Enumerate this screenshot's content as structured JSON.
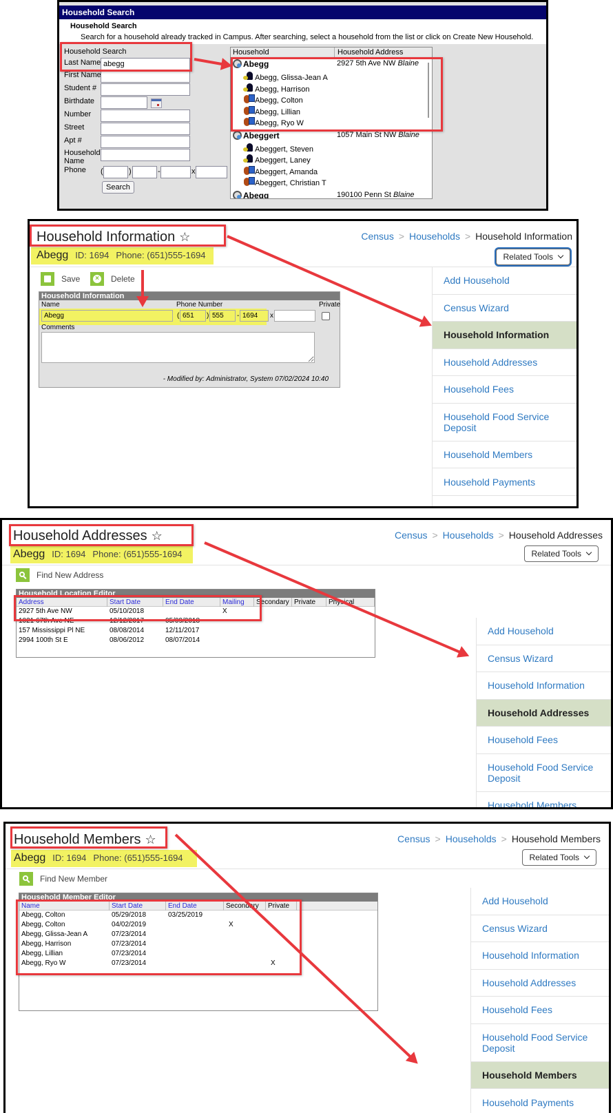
{
  "search_panel": {
    "window_title": "Household Search",
    "heading": "Household Search",
    "instructions": "Search for a household already tracked in Campus. After searching, select a household from the list or click on Create New Household.",
    "form_title": "Household Search",
    "fields": {
      "last_name_label": "Last Name",
      "last_name_value": "abegg",
      "first_name_label": "First Name",
      "student_num_label": "Student #",
      "birthdate_label": "Birthdate",
      "number_label": "Number",
      "street_label": "Street",
      "apt_label": "Apt #",
      "household_name_label": "Household Name",
      "phone_label": "Phone",
      "phone_paren_open": "(",
      "phone_paren_close": ")",
      "phone_dash": "-",
      "phone_ext": "x"
    },
    "search_button": "Search",
    "results": {
      "col_household": "Household",
      "col_address": "Household Address",
      "households": [
        {
          "name": "Abegg",
          "address": "2927 5th Ave NW",
          "city": "Blaine",
          "members": [
            {
              "name": "Abegg, Glissa-Jean A",
              "icon": "parent-icon"
            },
            {
              "name": "Abegg, Harrison",
              "icon": "parent-icon"
            },
            {
              "name": "Abegg, Colton",
              "icon": "student-icon"
            },
            {
              "name": "Abegg, Lillian",
              "icon": "student-icon"
            },
            {
              "name": "Abegg, Ryo W",
              "icon": "student-icon"
            }
          ]
        },
        {
          "name": "Abeggert",
          "address": "1057 Main St NW",
          "city": "Blaine",
          "members": [
            {
              "name": "Abeggert, Steven",
              "icon": "parent-icon"
            },
            {
              "name": "Abeggert, Laney",
              "icon": "parent-icon"
            },
            {
              "name": "Abeggert, Amanda",
              "icon": "student-icon"
            },
            {
              "name": "Abeggert, Christian T",
              "icon": "student-icon"
            }
          ]
        },
        {
          "name": "Abegg",
          "address": "190100 Penn St",
          "city": "Blaine",
          "members": []
        }
      ]
    }
  },
  "common": {
    "household_name": "Abegg",
    "household_id": "ID: 1694",
    "household_phone": "Phone: (651)555-1694",
    "breadcrumb_census": "Census",
    "breadcrumb_households": "Households",
    "related_tools": "Related Tools",
    "sidebar": [
      "Add Household",
      "Census Wizard",
      "Household Information",
      "Household Addresses",
      "Household Fees",
      "Household Food Service Deposit",
      "Household Members",
      "Household Payments"
    ]
  },
  "info_page": {
    "title": "Household Information",
    "breadcrumb_current": "Household Information",
    "active_sidebar": "Household Information",
    "save_label": "Save",
    "delete_label": "Delete",
    "editor_title": "Household Information",
    "name_label": "Name",
    "name_value": "Abegg",
    "phone_label": "Phone Number",
    "phone_area": "651",
    "phone_prefix": "555",
    "phone_line": "1694",
    "phone_ext": "",
    "private_label": "Private",
    "private_checked": false,
    "comments_label": "Comments",
    "comments_value": "",
    "modified_by": "- Modified by: Administrator, System 07/02/2024 10:40"
  },
  "addresses_page": {
    "title": "Household Addresses",
    "breadcrumb_current": "Household Addresses",
    "active_sidebar": "Household Addresses",
    "find_label": "Find New Address",
    "editor_title": "Household Location Editor",
    "columns": [
      "Address",
      "Start Date",
      "End Date",
      "Mailing",
      "Secondary",
      "Private",
      "Physical"
    ],
    "rows": [
      {
        "address": "2927 5th Ave NW",
        "start": "05/10/2018",
        "end": "",
        "mailing": "X",
        "secondary": "",
        "private": "",
        "physical": ""
      },
      {
        "address": "1021 67th Ave NE",
        "start": "12/12/2017",
        "end": "05/09/2018",
        "mailing": "",
        "secondary": "",
        "private": "",
        "physical": ""
      },
      {
        "address": "157 Mississippi Pl NE",
        "start": "08/08/2014",
        "end": "12/11/2017",
        "mailing": "",
        "secondary": "",
        "private": "",
        "physical": ""
      },
      {
        "address": "2994 100th St E",
        "start": "08/06/2012",
        "end": "08/07/2014",
        "mailing": "",
        "secondary": "",
        "private": "",
        "physical": ""
      }
    ]
  },
  "members_page": {
    "title": "Household Members",
    "breadcrumb_current": "Household Members",
    "active_sidebar": "Household Members",
    "find_label": "Find New Member",
    "editor_title": "Household Member Editor",
    "columns": [
      "Name",
      "Start Date",
      "End Date",
      "Secondary",
      "Private"
    ],
    "rows": [
      {
        "name": "Abegg, Colton",
        "start": "05/29/2018",
        "end": "03/25/2019",
        "secondary": "",
        "private": ""
      },
      {
        "name": "Abegg, Colton",
        "start": "04/02/2019",
        "end": "",
        "secondary": "X",
        "private": ""
      },
      {
        "name": "Abegg, Glissa-Jean A",
        "start": "07/23/2014",
        "end": "",
        "secondary": "",
        "private": ""
      },
      {
        "name": "Abegg, Harrison",
        "start": "07/23/2014",
        "end": "",
        "secondary": "",
        "private": ""
      },
      {
        "name": "Abegg, Lillian",
        "start": "07/23/2014",
        "end": "",
        "secondary": "",
        "private": ""
      },
      {
        "name": "Abegg, Ryo W",
        "start": "07/23/2014",
        "end": "",
        "secondary": "",
        "private": "X"
      }
    ]
  },
  "colors": {
    "annotation_red": "#e8383d",
    "highlight_yellow": "#f2f262",
    "link_blue": "#2f7ac2",
    "active_item_bg": "#d5dfc6",
    "legacy_titlebar": "#05056d",
    "action_green": "#8cc43c"
  }
}
